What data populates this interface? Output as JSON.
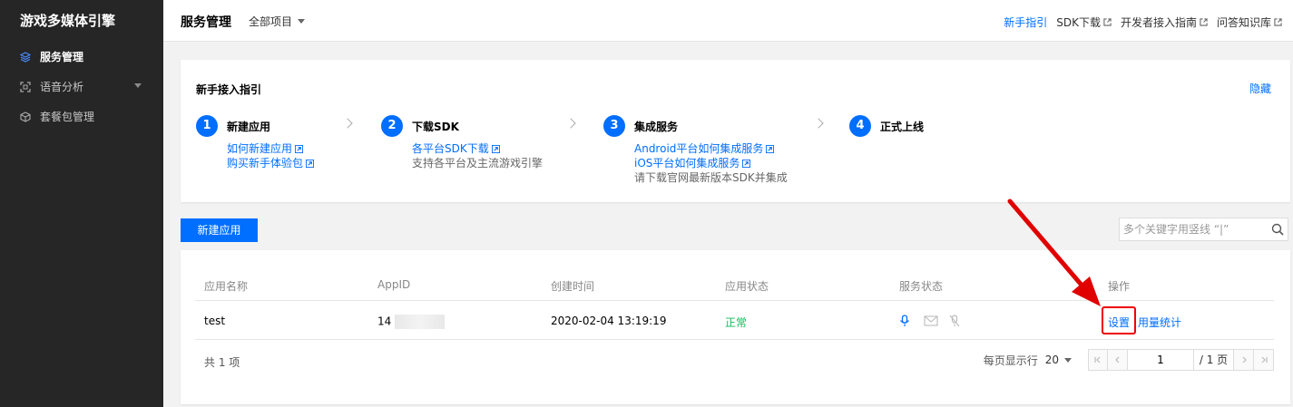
{
  "sidebar": {
    "brand": "游戏多媒体引擎",
    "items": [
      {
        "label": "服务管理",
        "icon": "layers-icon",
        "active": true
      },
      {
        "label": "语音分析",
        "icon": "scan-icon",
        "active": false
      },
      {
        "label": "套餐包管理",
        "icon": "package-icon",
        "active": false
      }
    ]
  },
  "header": {
    "title": "服务管理",
    "project_select": "全部项目",
    "links": [
      {
        "label": "新手指引"
      },
      {
        "label": "SDK下载"
      },
      {
        "label": "开发者接入指南"
      },
      {
        "label": "问答知识库"
      }
    ]
  },
  "guide": {
    "title": "新手接入指引",
    "hide": "隐藏",
    "steps": [
      {
        "num": "1",
        "title": "新建应用",
        "lines": [
          "如何新建应用",
          "购买新手体验包"
        ]
      },
      {
        "num": "2",
        "title": "下载SDK",
        "lines": [
          "各平台SDK下载",
          "支持各平台及主流游戏引擎"
        ]
      },
      {
        "num": "3",
        "title": "集成服务",
        "lines": [
          "Android平台如何集成服务",
          "iOS平台如何集成服务",
          "请下载官网最新版本SDK并集成"
        ]
      },
      {
        "num": "4",
        "title": "正式上线",
        "lines": []
      }
    ]
  },
  "toolbar": {
    "new_app": "新建应用",
    "search_placeholder": "多个关键字用竖线 “|”"
  },
  "table": {
    "headers": [
      "应用名称",
      "AppID",
      "创建时间",
      "应用状态",
      "服务状态",
      "操作"
    ],
    "rows": [
      {
        "name": "test",
        "appid_prefix": "14",
        "created": "2020-02-04 13:19:19",
        "status": "正常",
        "actions": [
          "设置",
          "用量统计"
        ]
      }
    ]
  },
  "footer": {
    "total": "共 1 项",
    "per_page_label": "每页显示行",
    "per_page": "20",
    "page": "1",
    "page_total": "/ 1 页"
  },
  "colors": {
    "accent": "#006eff",
    "status_ok": "#0abf5b",
    "annotation": "#e00000"
  }
}
